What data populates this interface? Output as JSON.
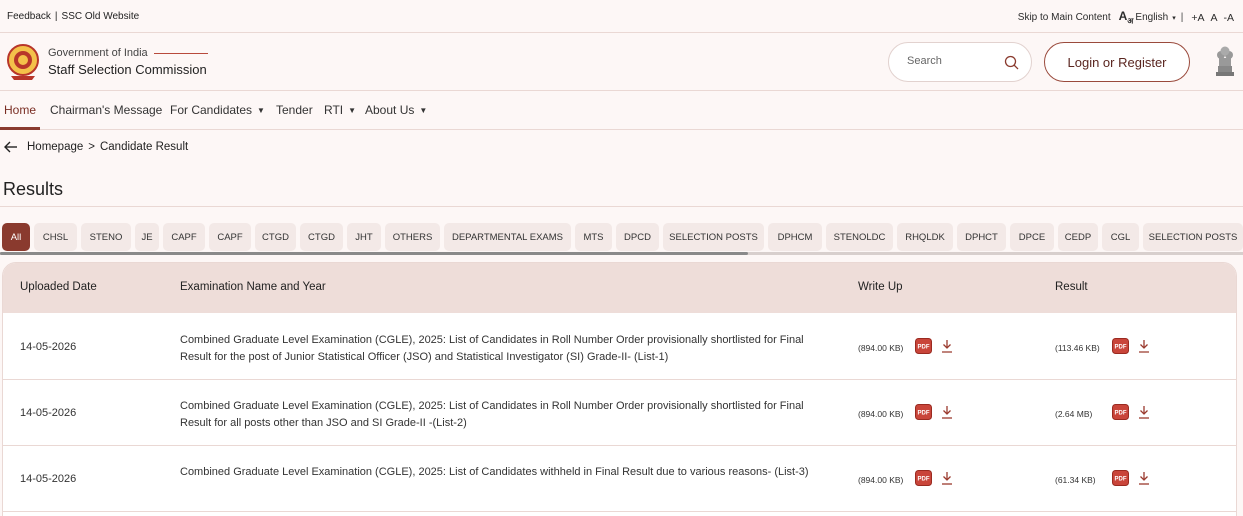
{
  "topbar": {
    "feedback": "Feedback",
    "old_site": "SSC Old Website",
    "skip": "Skip to Main Content",
    "language": "English",
    "font_larger": "+A",
    "font_normal": "A",
    "font_smaller": "-A"
  },
  "header": {
    "gov": "Government of India",
    "org": "Staff Selection Commission",
    "search_placeholder": "Search",
    "login": "Login or Register"
  },
  "nav": [
    {
      "label": "Home",
      "dropdown": false
    },
    {
      "label": "Chairman's Message",
      "dropdown": false
    },
    {
      "label": "For Candidates",
      "dropdown": true
    },
    {
      "label": "Tender",
      "dropdown": false
    },
    {
      "label": "RTI",
      "dropdown": true
    },
    {
      "label": "About Us",
      "dropdown": true
    }
  ],
  "breadcrumb": {
    "home": "Homepage",
    "sep": ">",
    "current": "Candidate Result"
  },
  "page_title": "Results",
  "tabs": [
    "All",
    "CHSL",
    "STENO",
    "JE",
    "CAPF",
    "CAPF",
    "CTGD",
    "CTGD",
    "JHT",
    "OTHERS",
    "DEPARTMENTAL EXAMS",
    "MTS",
    "DPCD",
    "SELECTION POSTS",
    "DPHCM",
    "STENOLDC",
    "RHQLDK",
    "DPHCT",
    "DPCE",
    "CEDP",
    "CGL",
    "SELECTION POSTS"
  ],
  "table": {
    "headers": {
      "date": "Uploaded Date",
      "name": "Examination Name and Year",
      "writeup": "Write Up",
      "result": "Result"
    },
    "rows": [
      {
        "date": "14-05-2026",
        "name": "Combined Graduate Level Examination (CGLE), 2025: List of Candidates in Roll Number Order provisionally shortlisted for Final Result for the post of Junior Statistical Officer (JSO) and Statistical Investigator (SI) Grade-II- (List-1)",
        "writeup_size": "(894.00 KB)",
        "result_size": "(113.46 KB)"
      },
      {
        "date": "14-05-2026",
        "name": "Combined Graduate Level Examination (CGLE), 2025: List of Candidates in Roll Number Order provisionally shortlisted for Final Result for all posts other than JSO and SI Grade-II -(List-2)",
        "writeup_size": "(894.00 KB)",
        "result_size": "(2.64 MB)"
      },
      {
        "date": "14-05-2026",
        "name": "Combined Graduate Level Examination (CGLE), 2025: List of Candidates withheld in Final Result due to various reasons- (List-3)",
        "writeup_size": "(894.00 KB)",
        "result_size": "(61.34 KB)"
      }
    ]
  },
  "colors": {
    "accent": "#8a3a2e",
    "header_bg": "#eeddd9",
    "page_bg": "#fdf7f6"
  }
}
